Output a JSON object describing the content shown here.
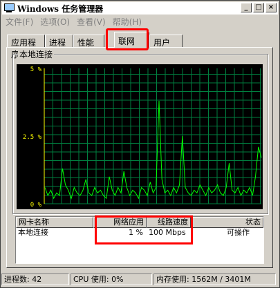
{
  "window": {
    "title": "Windows 任务管理器",
    "buttons": {
      "minimize": "_",
      "maximize": "□",
      "close": "×"
    }
  },
  "menubar": {
    "items": [
      "文件(F)",
      "选项(O)",
      "查看(V)",
      "帮助(H)"
    ]
  },
  "tabs": [
    {
      "label": "应用程序"
    },
    {
      "label": "进程"
    },
    {
      "label": "性能"
    },
    {
      "label": "联网",
      "active": true
    },
    {
      "label": "用户"
    }
  ],
  "network": {
    "group_label": "本地连接",
    "y_ticks": [
      "5 %",
      "2.5 %",
      "0 %"
    ],
    "chart_data": {
      "type": "line",
      "ylim": [
        0,
        5
      ],
      "unit": "%",
      "grid": true,
      "series": [
        {
          "values": [
            0.6,
            0.3,
            0.5,
            0.2,
            0.4,
            0.3,
            1.3,
            0.7,
            0.5,
            0.2,
            0.6,
            0.4,
            0.3,
            0.5,
            0.9,
            0.4,
            0.3,
            0.6,
            0.4,
            0.5,
            0.3,
            0.2,
            1.0,
            0.5,
            0.3,
            0.6,
            0.4,
            1.2,
            0.6,
            0.3,
            0.5,
            0.4,
            0.2,
            0.6,
            0.5,
            0.3,
            0.8,
            0.4,
            0.6,
            3.8,
            0.9,
            0.4,
            0.5,
            0.3,
            0.6,
            0.4,
            0.7,
            2.5,
            0.6,
            0.4,
            0.3,
            0.5,
            0.4,
            0.7,
            0.5,
            0.3,
            0.6,
            0.4,
            0.5,
            0.7,
            0.4,
            0.3,
            0.6,
            1.5,
            0.5,
            0.4,
            0.6,
            0.3,
            0.5,
            0.4,
            0.6,
            0.3,
            1.0,
            2.1,
            1.7
          ]
        }
      ]
    }
  },
  "adapter_table": {
    "headers": [
      "网卡名称",
      "网络应用",
      "线路速度",
      "状态"
    ],
    "rows": [
      {
        "name": "本地连接",
        "utilization": "1 %",
        "speed": "100 Mbps",
        "state": "可操作"
      }
    ]
  },
  "statusbar": {
    "processes": "进程数: 42",
    "cpu": "CPU 使用: 0%",
    "memory": "内存使用: 1562M / 3401M"
  },
  "colors": {
    "graph_bg": "#000000",
    "grid": "#008040",
    "line": "#00ff00",
    "axis": "#ffff00",
    "highlight": "#ff0000"
  }
}
